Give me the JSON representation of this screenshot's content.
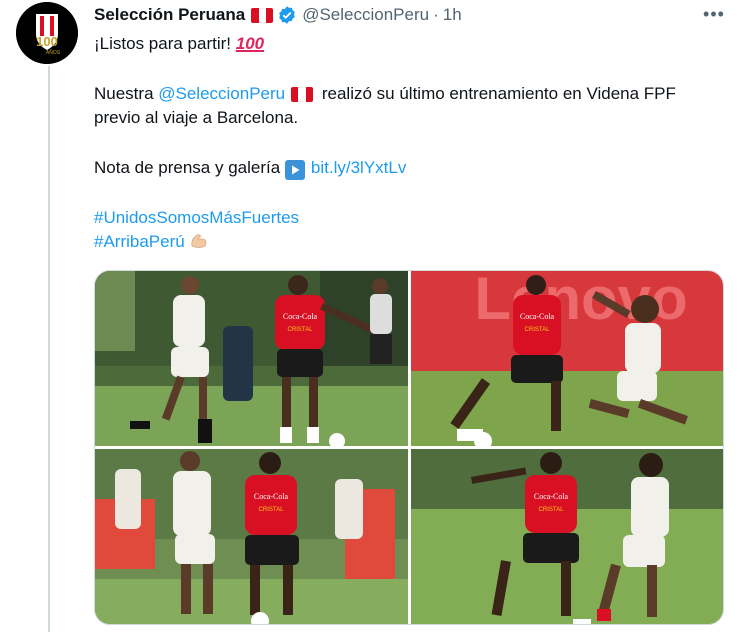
{
  "tweet": {
    "author_name": "Selección Peruana",
    "author_handle": "@SeleccionPeru",
    "separator": "·",
    "time": "1h",
    "more_label": "•••",
    "avatar_text": "100",
    "avatar_subtext": "AÑOS",
    "line1": "¡Listos para partir!",
    "line1_emoji": "100",
    "p2_prefix": "Nuestra ",
    "p2_mention": "@SeleccionPeru",
    "p2_suffix_a": " realizó su último entrenamiento en Videna FPF",
    "p2_suffix_b": "previo al viaje a Barcelona.",
    "p3_prefix": "Nota de prensa y galería ",
    "p3_link": "bit.ly/3lYxtLv",
    "hashtag1": "#UnidosSomosMásFuertes",
    "hashtag2": "#ArribaPerú"
  },
  "media": {
    "photos": [
      {
        "alt": "player-training-photo-1"
      },
      {
        "alt": "player-training-photo-2"
      },
      {
        "alt": "player-training-photo-3"
      },
      {
        "alt": "player-training-photo-4"
      }
    ],
    "shirt_sponsor": "Coca-Cola",
    "shirt_sponsor2": "CRISTAL",
    "banner_text": "Lenovo"
  },
  "colors": {
    "accent": "#1d9bf0",
    "text": "#0f1419",
    "muted": "#536471",
    "peru_red": "#d91023",
    "verified": "#1d9bf0"
  }
}
